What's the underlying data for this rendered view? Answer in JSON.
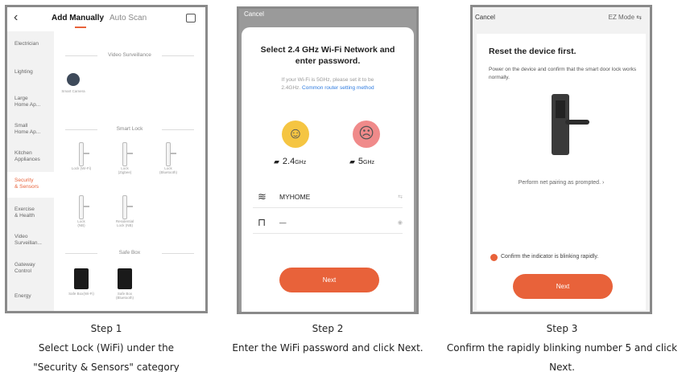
{
  "step1": {
    "back_glyph": "‹",
    "tabs": [
      "Add Manually",
      "Auto Scan"
    ],
    "sidebar": [
      {
        "line1": "Electrician",
        "line2": ""
      },
      {
        "line1": "Lighting",
        "line2": ""
      },
      {
        "line1": "Large",
        "line2": "Home Ap..."
      },
      {
        "line1": "Small",
        "line2": "Home Ap..."
      },
      {
        "line1": "Kitchen",
        "line2": "Appliances"
      },
      {
        "line1": "Security",
        "line2": "& Sensors"
      },
      {
        "line1": "Exercise",
        "line2": "& Health"
      },
      {
        "line1": "Video",
        "line2": "Surveillan..."
      },
      {
        "line1": "Gateway",
        "line2": "Control"
      },
      {
        "line1": "Energy",
        "line2": ""
      }
    ],
    "sections": [
      "Video Surveillance",
      "Smart Lock",
      "Safe Box"
    ],
    "devices": {
      "camera": "Smart Camera",
      "locks": [
        {
          "line1": "Lock (Wi-Fi)",
          "line2": ""
        },
        {
          "line1": "Lock",
          "line2": "(Zigbee)"
        },
        {
          "line1": "Lock",
          "line2": "(Bluetooth)"
        },
        {
          "line1": "Lock",
          "line2": "(NB)"
        },
        {
          "line1": "Residential",
          "line2": "Lock (NB)"
        }
      ],
      "safes": [
        {
          "line1": "Safe Box(Wi-Fi)",
          "line2": ""
        },
        {
          "line1": "Safe Box",
          "line2": "(Bluetooth)"
        }
      ]
    }
  },
  "step2": {
    "cancel": "Cancel",
    "title_line1": "Select 2.4 GHz Wi-Fi Network and",
    "title_line2": "enter password.",
    "hint_line1": "If your Wi-Fi is 5GHz, please set it to be",
    "hint_line2_prefix": "2.4GHz.",
    "hint_link": "Common router setting method",
    "band_24_num": "2.4",
    "band_24_unit": "GHz",
    "band_5_num": "5",
    "band_5_unit": "GHz",
    "ssid": "MYHOME",
    "password_mask": "—",
    "next": "Next"
  },
  "step3": {
    "cancel": "Cancel",
    "mode": "EZ Mode ⇆",
    "title": "Reset the device first.",
    "desc": "Power on the device and confirm that the smart door lock works normally.",
    "prompt": "Perform net pairing as prompted. ›",
    "confirm": "Confirm the indicator is blinking rapidly.",
    "next": "Next"
  },
  "captions": {
    "step1_title": "Step 1",
    "step1_line1": "Select Lock (WiFi) under the",
    "step1_line2": "\"Security & Sensors\" category",
    "step2_title": "Step 2",
    "step2_line1": "Enter the WiFi password and click Next.",
    "step3_title": "Step 3",
    "step3_line1": "Confirm the rapidly blinking number 5 and click Next."
  },
  "colors": {
    "accent": "#e8623a",
    "link": "#2f7ce0",
    "happy": "#f5c542",
    "sad": "#f08a8a"
  }
}
